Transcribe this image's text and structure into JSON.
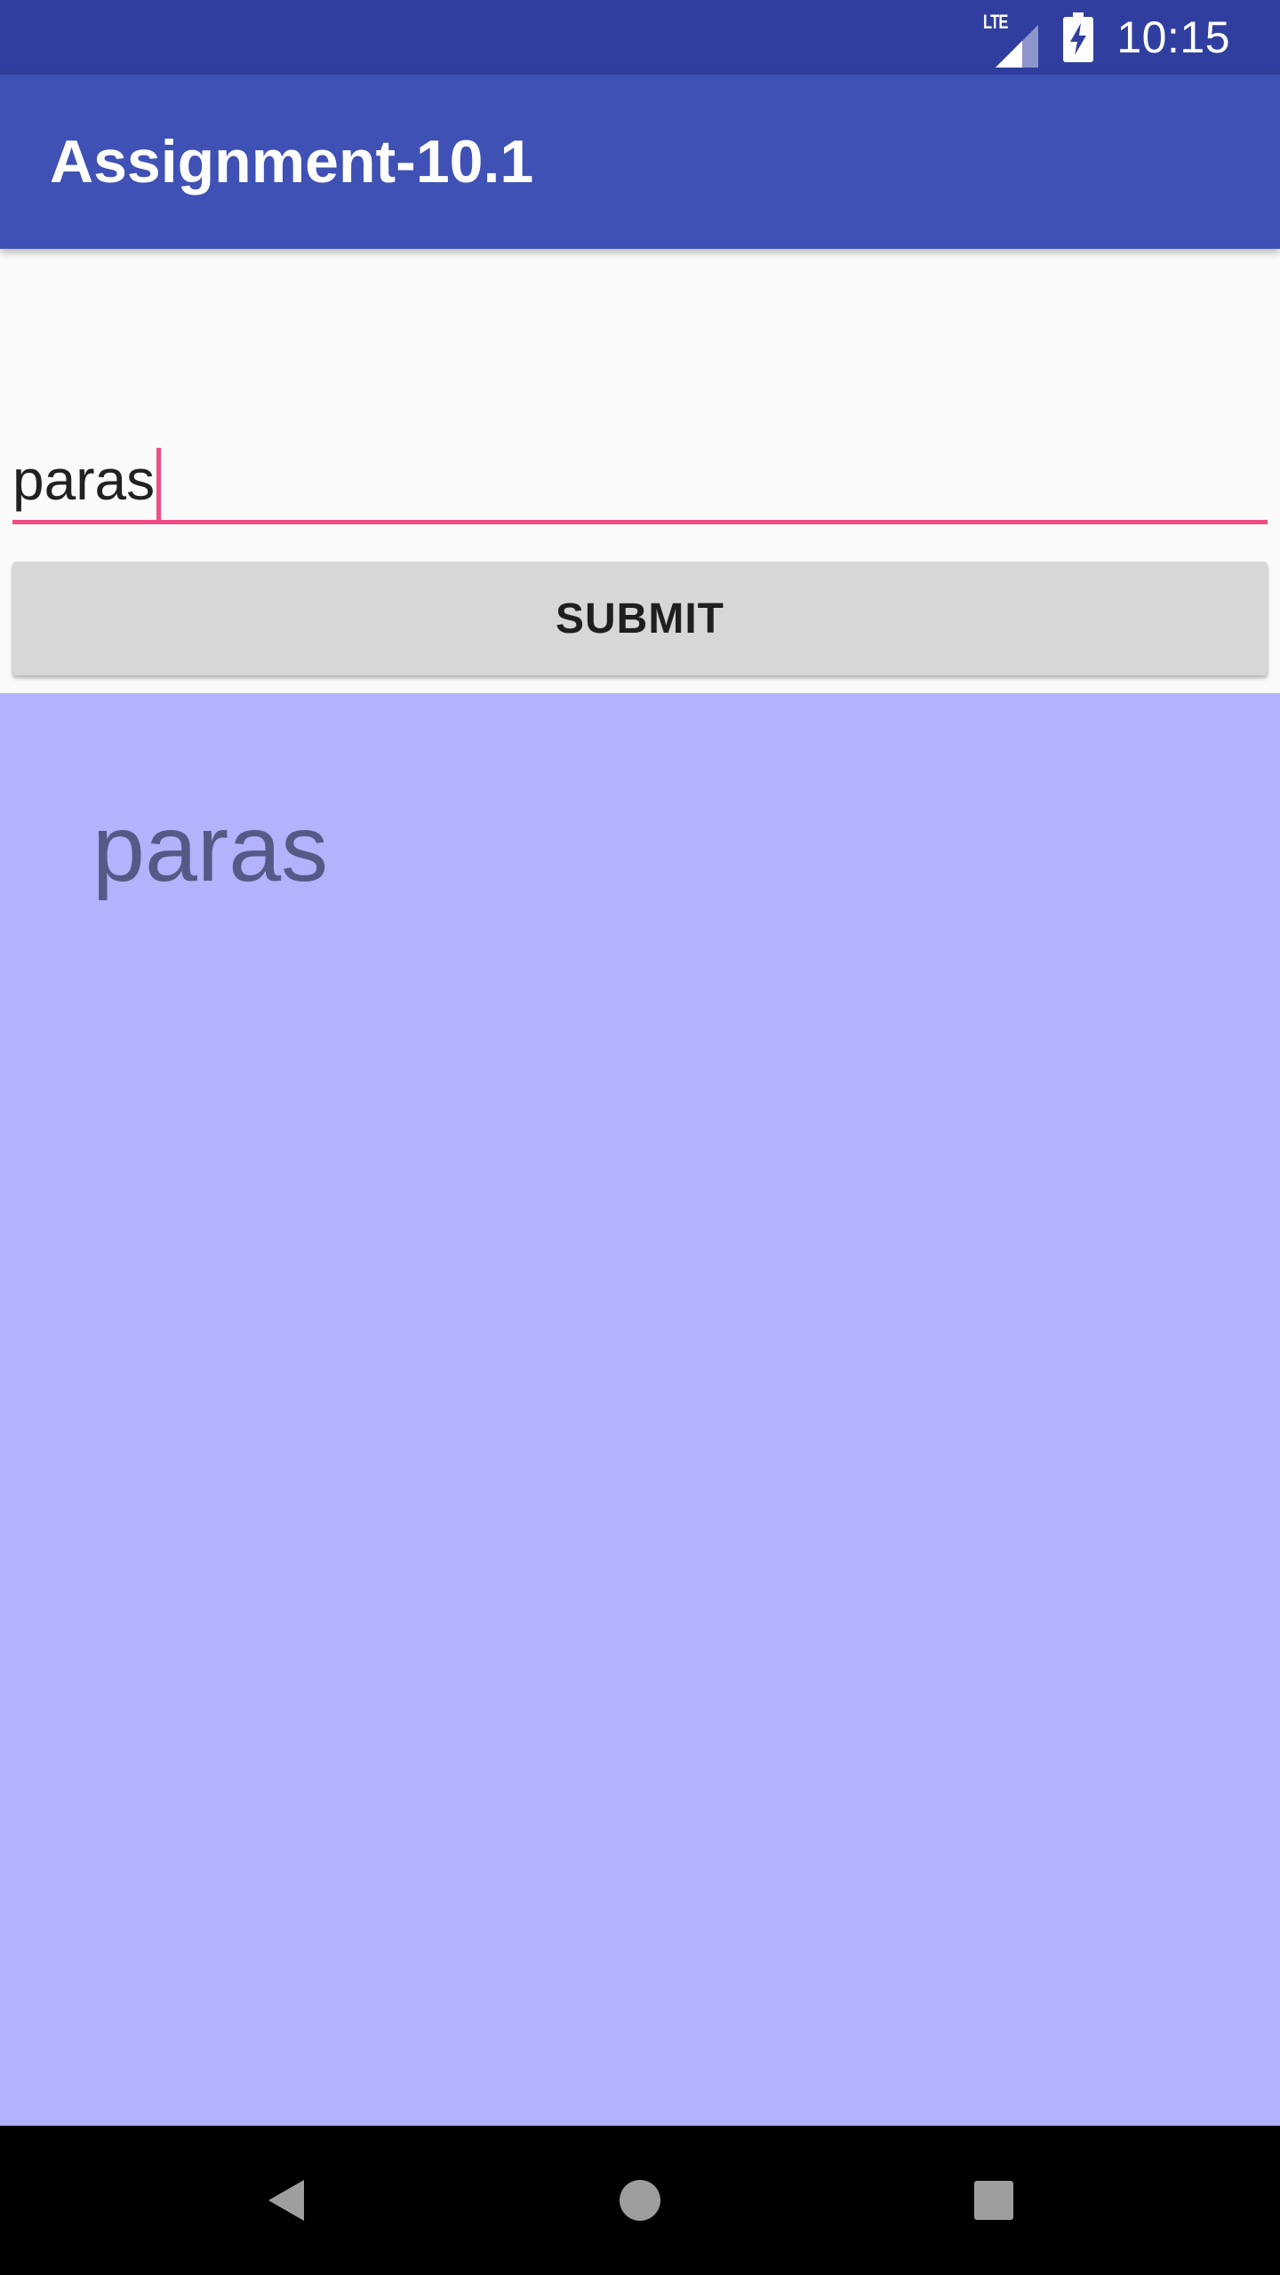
{
  "status_bar": {
    "network_label": "LTE",
    "time": "10:15",
    "icons": [
      "lte-signal-icon",
      "battery-charging-icon"
    ]
  },
  "app_bar": {
    "title": "Assignment-10.1"
  },
  "form": {
    "input_value": "paras",
    "submit_label": "SUBMIT"
  },
  "output": {
    "text": "paras"
  },
  "nav_bar": {
    "icons": [
      "back-icon",
      "home-icon",
      "recents-icon"
    ]
  },
  "colors": {
    "status_bar": "#303F9F",
    "app_bar": "#3F51B5",
    "accent": "#F04C85",
    "button": "#D6D7D7",
    "output_background": "#B2B2FD",
    "output_text": "#545A86"
  }
}
